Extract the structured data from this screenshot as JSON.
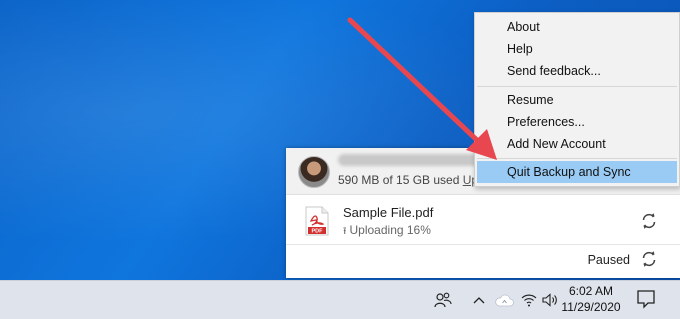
{
  "menu": {
    "items": [
      {
        "label": "About"
      },
      {
        "label": "Help"
      },
      {
        "label": "Send feedback..."
      },
      {
        "label": "Resume"
      },
      {
        "label": "Preferences..."
      },
      {
        "label": "Add New Account"
      },
      {
        "label": "Quit Backup and Sync",
        "highlighted": true
      }
    ]
  },
  "account": {
    "storage_text": "590 MB of 15 GB used",
    "storage_link": "Up"
  },
  "file": {
    "name": "Sample File.pdf",
    "status": "Uploading 16%",
    "progress_percent": 16,
    "icon": "pdf-file-icon",
    "icon_text": "PDF"
  },
  "status": {
    "label": "Paused"
  },
  "taskbar": {
    "time": "6:02 AM",
    "date": "11/29/2020",
    "icons": [
      "people-icon",
      "chevron-up-icon",
      "cloud-icon",
      "wifi-icon",
      "speaker-icon",
      "notification-icon"
    ]
  },
  "colors": {
    "desktop": "#0a63c8",
    "menu_highlight": "#99cbf4",
    "arrow": "#e8474f",
    "pdf_red": "#d32f2f"
  }
}
